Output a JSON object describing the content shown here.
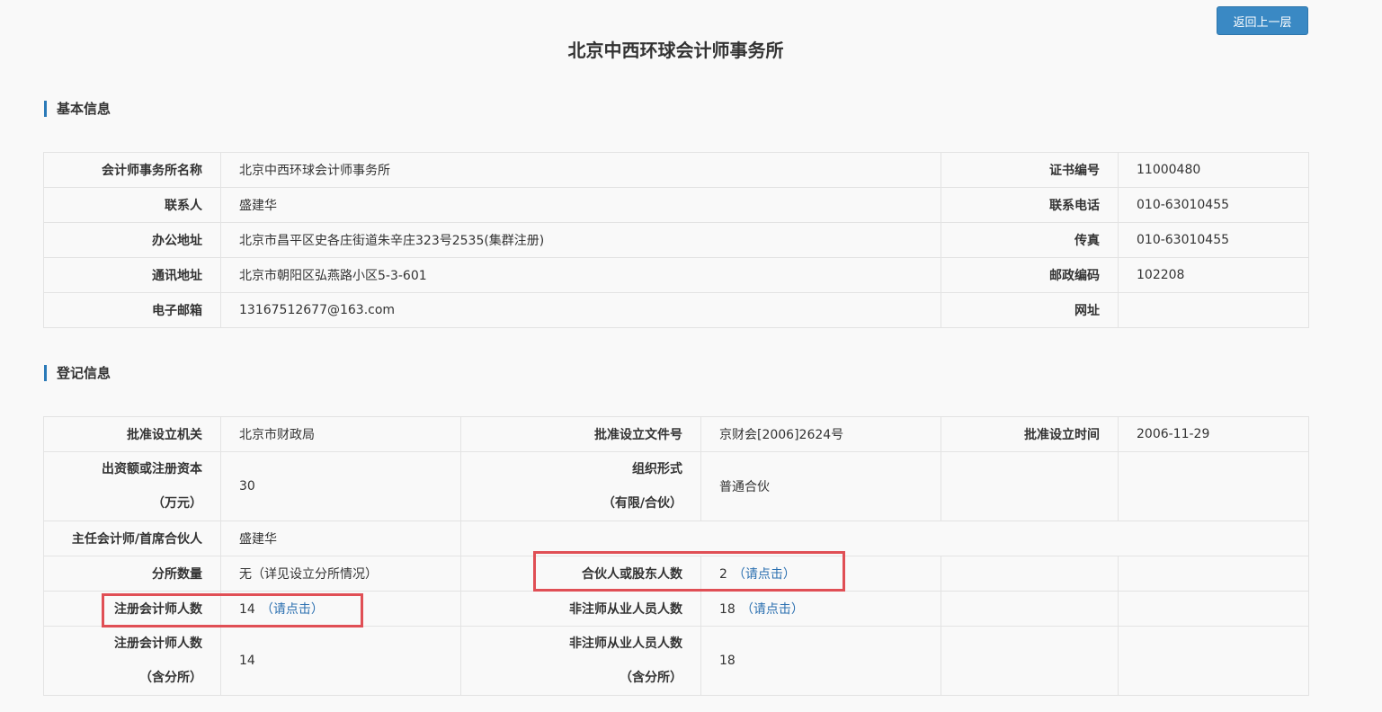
{
  "page": {
    "title": "北京中西环球会计师事务所",
    "back_button": "返回上一层"
  },
  "basic": {
    "section_title": "基本信息",
    "rows": [
      {
        "l1": "会计师事务所名称",
        "v1": "北京中西环球会计师事务所",
        "l2": "证书编号",
        "v2": "11000480"
      },
      {
        "l1": "联系人",
        "v1": "盛建华",
        "l2": "联系电话",
        "v2": "010-63010455"
      },
      {
        "l1": "办公地址",
        "v1": "北京市昌平区史各庄街道朱辛庄323号2535(集群注册)",
        "l2": "传真",
        "v2": "010-63010455"
      },
      {
        "l1": "通讯地址",
        "v1": "北京市朝阳区弘燕路小区5-3-601",
        "l2": "邮政编码",
        "v2": "102208"
      },
      {
        "l1": "电子邮箱",
        "v1": "13167512677@163.com",
        "l2": "网址",
        "v2": ""
      }
    ]
  },
  "registration": {
    "section_title": "登记信息",
    "approval_authority_label": "批准设立机关",
    "approval_authority": "北京市财政局",
    "approval_doc_label": "批准设立文件号",
    "approval_doc": "京财会[2006]2624号",
    "approval_date_label": "批准设立时间",
    "approval_date": "2006-11-29",
    "capital_label_1": "出资额或注册资本",
    "capital_label_2": "（万元）",
    "capital": "30",
    "org_form_label_1": "组织形式",
    "org_form_label_2": "（有限/合伙）",
    "org_form": "普通合伙",
    "chief_label": "主任会计师/首席合伙人",
    "chief": "盛建华",
    "branches_label": "分所数量",
    "branches": "无（详见设立分所情况）",
    "partners_label": "合伙人或股东人数",
    "partners": "2",
    "partners_link": "（请点击）",
    "cpa_label": "注册会计师人数",
    "cpa": "14",
    "cpa_link": "（请点击）",
    "non_cpa_label": "非注师从业人员人数",
    "non_cpa": "18",
    "non_cpa_link": "（请点击）",
    "cpa_total_label_1": "注册会计师人数",
    "cpa_total_label_2": "（含分所）",
    "cpa_total": "14",
    "non_cpa_total_label_1": "非注师从业人员人数",
    "non_cpa_total_label_2": "（含分所）",
    "non_cpa_total": "18"
  },
  "colors": {
    "accent": "#3a89c4",
    "highlight": "#e04f55",
    "link": "#2a6fb0"
  }
}
